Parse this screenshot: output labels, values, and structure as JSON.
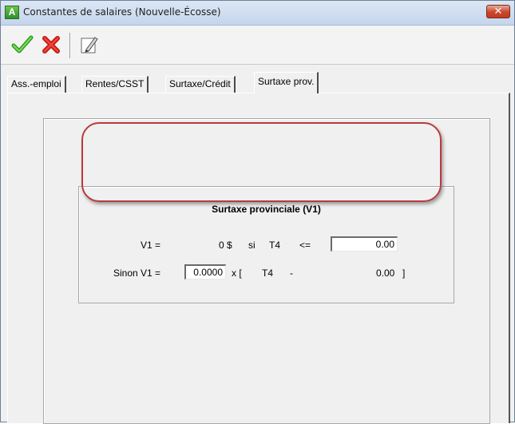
{
  "window": {
    "title": "Constantes de salaires (Nouvelle-Écosse)",
    "close_glyph": "✕",
    "app_icon_letter": "A"
  },
  "toolbar": {
    "buttons": [
      {
        "icon": "checkmark-icon",
        "color": "#3cae2a"
      },
      {
        "icon": "cancel-x-icon",
        "color": "#e0231a"
      },
      {
        "icon": "edit-pencil-icon",
        "color": "#555555"
      }
    ]
  },
  "tabs": [
    {
      "label": "Ass.-emploi",
      "active": false
    },
    {
      "label": "Rentes/CSST",
      "active": false
    },
    {
      "label": "Surtaxe/Crédit",
      "active": false
    },
    {
      "label": "Surtaxe prov.",
      "active": true
    }
  ],
  "section": {
    "title": "Surtaxe provinciale  (V1)",
    "row1": {
      "label": "V1  =",
      "amount": "0 $",
      "si": "si",
      "var": "T4",
      "op": "<=",
      "threshold_value": "0.00"
    },
    "row2": {
      "label": "Sinon V1  =",
      "rate_value": "0.0000",
      "x_bracket": "x  [",
      "var": "T4",
      "minus": "-",
      "value": "0.00",
      "close_bracket": "]"
    }
  },
  "colors": {
    "highlight_outline": "#b83b3b",
    "close_button": "#c8452b"
  }
}
